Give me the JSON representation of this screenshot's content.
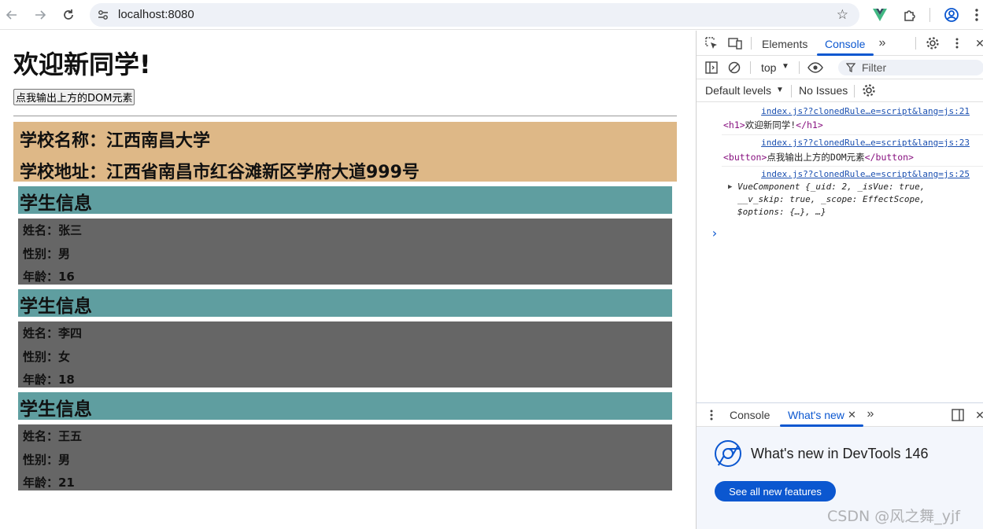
{
  "browser": {
    "url": "localhost:8080"
  },
  "page": {
    "heading": "欢迎新同学!",
    "button_label": "点我输出上方的DOM元素",
    "school": {
      "name_line": "学校名称：江西南昌大学",
      "address_line": "学校地址：江西省南昌市红谷滩新区学府大道999号"
    },
    "students": [
      {
        "title": "学生信息",
        "name": "姓名：张三",
        "gender": "性别：男",
        "age": "年龄：16"
      },
      {
        "title": "学生信息",
        "name": "姓名：李四",
        "gender": "性别：女",
        "age": "年龄：18"
      },
      {
        "title": "学生信息",
        "name": "姓名：王五",
        "gender": "性别：男",
        "age": "年龄：21"
      }
    ]
  },
  "devtools": {
    "tabs": {
      "elements": "Elements",
      "console": "Console"
    },
    "context": "top",
    "filter_placeholder": "Filter",
    "levels": "Default levels",
    "issues": "No Issues",
    "console": {
      "src1": "index.js??clonedRule…e=script&lang=js:21",
      "line1_text": "欢迎新同学!",
      "line1_open": "<h1>",
      "line1_close": "</h1>",
      "src2": "index.js??clonedRule…e=script&lang=js:23",
      "line2_open": "<button>",
      "line2_text": "点我输出上方的DOM元素",
      "line2_close": "</button>",
      "src3": "index.js??clonedRule…e=script&lang=js:25",
      "obj_line": "VueComponent  {_uid: 2, _isVue: true, __v_skip: true, _scope: EffectScope, $options: {…}, …}",
      "prompt": "›"
    },
    "drawer": {
      "tab_console": "Console",
      "tab_whatsnew": "What's new",
      "title": "What's new in DevTools 146",
      "button": "See all new features"
    }
  },
  "watermark": "CSDN @风之舞_yjf",
  "colors": {
    "school_bg": "#deb887",
    "student_title_bg": "#5f9ea0",
    "student_body_bg": "#666666",
    "devtools_accent": "#0b57d0"
  }
}
